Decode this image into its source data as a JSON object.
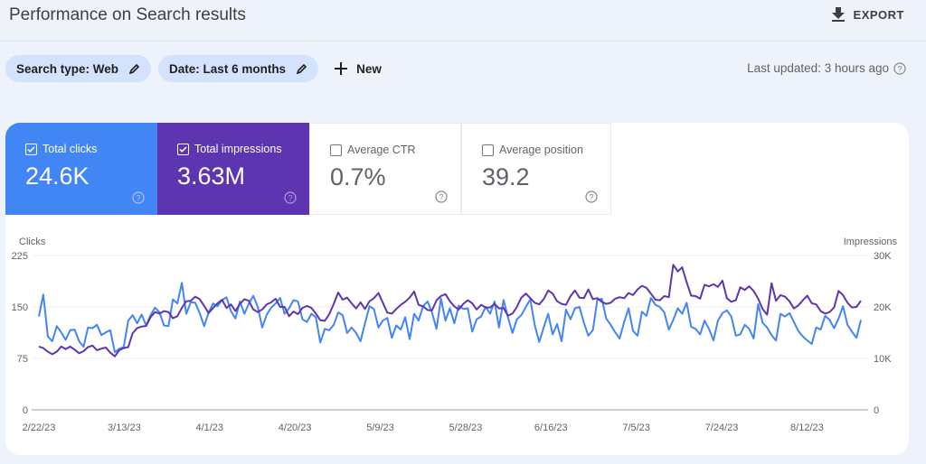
{
  "header": {
    "title": "Performance on Search results",
    "export_label": "EXPORT"
  },
  "filters": {
    "chips": [
      {
        "label": "Search type: Web"
      },
      {
        "label": "Date: Last 6 months"
      }
    ],
    "new_label": "New",
    "last_updated": "Last updated: 3 hours ago"
  },
  "metrics": [
    {
      "label": "Total clicks",
      "value": "24.6K",
      "checked": true,
      "color": "#4285f4"
    },
    {
      "label": "Total impressions",
      "value": "3.63M",
      "checked": true,
      "color": "#5e35b1"
    },
    {
      "label": "Average CTR",
      "value": "0.7%",
      "checked": false
    },
    {
      "label": "Average position",
      "value": "39.2",
      "checked": false
    }
  ],
  "chart_data": {
    "type": "line",
    "title": "",
    "y_left_label": "Clicks",
    "y_right_label": "Impressions",
    "y_left_ticks": [
      "0",
      "75",
      "150",
      "225"
    ],
    "y_right_ticks": [
      "0",
      "10K",
      "20K",
      "30K"
    ],
    "ylim_left": [
      0,
      225
    ],
    "ylim_right": [
      0,
      30000
    ],
    "x_ticks": [
      "2/22/23",
      "3/13/23",
      "4/1/23",
      "4/20/23",
      "5/9/23",
      "5/28/23",
      "6/16/23",
      "7/5/23",
      "7/24/23",
      "8/12/23"
    ],
    "x_range": [
      "2/22/23",
      "8/23/23"
    ],
    "grid": true,
    "series": [
      {
        "name": "Clicks",
        "axis": "left",
        "color": "#4285f4",
        "values": [
          136,
          168,
          107,
          100,
          122,
          113,
          102,
          116,
          117,
          100,
          92,
          120,
          119,
          124,
          109,
          113,
          116,
          84,
          89,
          92,
          130,
          138,
          126,
          139,
          123,
          138,
          149,
          142,
          123,
          122,
          161,
          155,
          185,
          140,
          157,
          156,
          141,
          122,
          142,
          155,
          151,
          160,
          164,
          144,
          133,
          158,
          140,
          155,
          166,
          150,
          120,
          139,
          149,
          155,
          163,
          140,
          148,
          160,
          158,
          132,
          128,
          140,
          135,
          98,
          118,
          116,
          124,
          142,
          138,
          112,
          120,
          112,
          100,
          126,
          151,
          147,
          120,
          130,
          134,
          105,
          123,
          117,
          135,
          103,
          140,
          130,
          151,
          158,
          142,
          118,
          162,
          130,
          148,
          126,
          152,
          147,
          148,
          114,
          132,
          136,
          150,
          140,
          158,
          120,
          160,
          135,
          112,
          132,
          138,
          150,
          161,
          123,
          99,
          120,
          140,
          110,
          125,
          100,
          146,
          132,
          148,
          150,
          127,
          108,
          116,
          160,
          162,
          133,
          124,
          113,
          104,
          128,
          148,
          115,
          108,
          143,
          137,
          163,
          153,
          150,
          142,
          117,
          131,
          148,
          140,
          156,
          121,
          118,
          110,
          130,
          118,
          101,
          130,
          141,
          145,
          136,
          108,
          110,
          124,
          118,
          104,
          154,
          127,
          120,
          109,
          101,
          140,
          136,
          141,
          128,
          115,
          107,
          101,
          96,
          120,
          117,
          137,
          131,
          119,
          133,
          151,
          124,
          114,
          105,
          131
        ],
        "note": "approximate daily values read from chart"
      },
      {
        "name": "Impressions",
        "axis": "right",
        "color": "#5e35b1",
        "values": [
          12300,
          12000,
          11300,
          10800,
          11300,
          12300,
          11800,
          12300,
          11700,
          11000,
          11400,
          12200,
          12500,
          11600,
          11900,
          12100,
          11100,
          10400,
          11600,
          12000,
          12200,
          14900,
          15900,
          16200,
          16300,
          18000,
          19000,
          18700,
          19200,
          19000,
          17800,
          18200,
          19800,
          21100,
          21200,
          22000,
          21500,
          20200,
          18800,
          19800,
          20700,
          21400,
          19800,
          20500,
          19200,
          20600,
          21500,
          21200,
          19500,
          19000,
          19500,
          20500,
          20900,
          21600,
          20000,
          20000,
          18200,
          19100,
          18600,
          19800,
          20200,
          19800,
          18700,
          17400,
          17300,
          18600,
          20600,
          22800,
          21400,
          21800,
          20700,
          19700,
          20900,
          19600,
          21100,
          21700,
          22700,
          20800,
          18900,
          18700,
          19600,
          20400,
          21000,
          21800,
          23000,
          20400,
          20100,
          19400,
          19300,
          21300,
          22100,
          22500,
          21100,
          20100,
          19500,
          20600,
          21300,
          20700,
          19500,
          20400,
          19900,
          19900,
          20600,
          19700,
          19800,
          18300,
          18700,
          20000,
          21800,
          22600,
          21700,
          20800,
          20500,
          21500,
          23200,
          22600,
          21100,
          20600,
          20400,
          22100,
          23200,
          21800,
          21700,
          23400,
          21500,
          21700,
          21000,
          20600,
          20800,
          21600,
          21900,
          21700,
          22700,
          22300,
          23400,
          24100,
          23700,
          22600,
          21400,
          21300,
          22100,
          21900,
          28200,
          26900,
          27700,
          24800,
          22200,
          22100,
          21600,
          24300,
          24000,
          24400,
          23900,
          25100,
          21700,
          21000,
          21300,
          23800,
          23300,
          24000,
          23100,
          21600,
          19600,
          18500,
          24600,
          21200,
          22300,
          22000,
          21100,
          19700,
          20300,
          21300,
          22200,
          20700,
          20500,
          19200,
          18700,
          19000,
          19900,
          23100,
          22300,
          20800,
          19900,
          20000,
          21200
        ]
      }
    ]
  }
}
